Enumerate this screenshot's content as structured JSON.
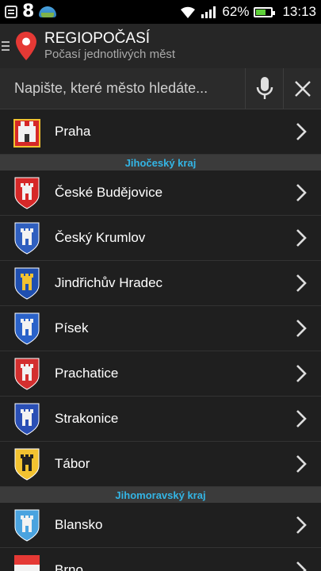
{
  "status_bar": {
    "notification_count": "8",
    "battery_percent": "62%",
    "battery_level": 0.62,
    "time": "13:13",
    "icons": [
      "notification-icon",
      "weather-icon",
      "wifi-icon",
      "signal-icon",
      "battery-icon"
    ]
  },
  "app_bar": {
    "title": "REGIOPOČASÍ",
    "subtitle": "Počasí jednotlivých měst",
    "icon": "map-pin-icon",
    "accent": "#e53935"
  },
  "search": {
    "placeholder": "Napište, které město hledáte...",
    "value": "",
    "mic_icon": "microphone-icon",
    "clear_icon": "close-icon"
  },
  "list": {
    "header_color": "#33b5e5",
    "top_item": {
      "name": "Praha",
      "crest": "praha"
    },
    "sections": [
      {
        "title": "Jihočeský kraj",
        "items": [
          {
            "name": "České Budějovice",
            "crest": "red-tower"
          },
          {
            "name": "Český Krumlov",
            "crest": "blue-castle"
          },
          {
            "name": "Jindřichův Hradec",
            "crest": "gold-lion"
          },
          {
            "name": "Písek",
            "crest": "blue-tower"
          },
          {
            "name": "Prachatice",
            "crest": "red-lion"
          },
          {
            "name": "Strakonice",
            "crest": "blue-gate"
          },
          {
            "name": "Tábor",
            "crest": "eagle"
          }
        ]
      },
      {
        "title": "Jihomoravský kraj",
        "items": [
          {
            "name": "Blansko",
            "crest": "sky-tower"
          },
          {
            "name": "Brno",
            "crest": "red-white"
          }
        ]
      }
    ]
  }
}
